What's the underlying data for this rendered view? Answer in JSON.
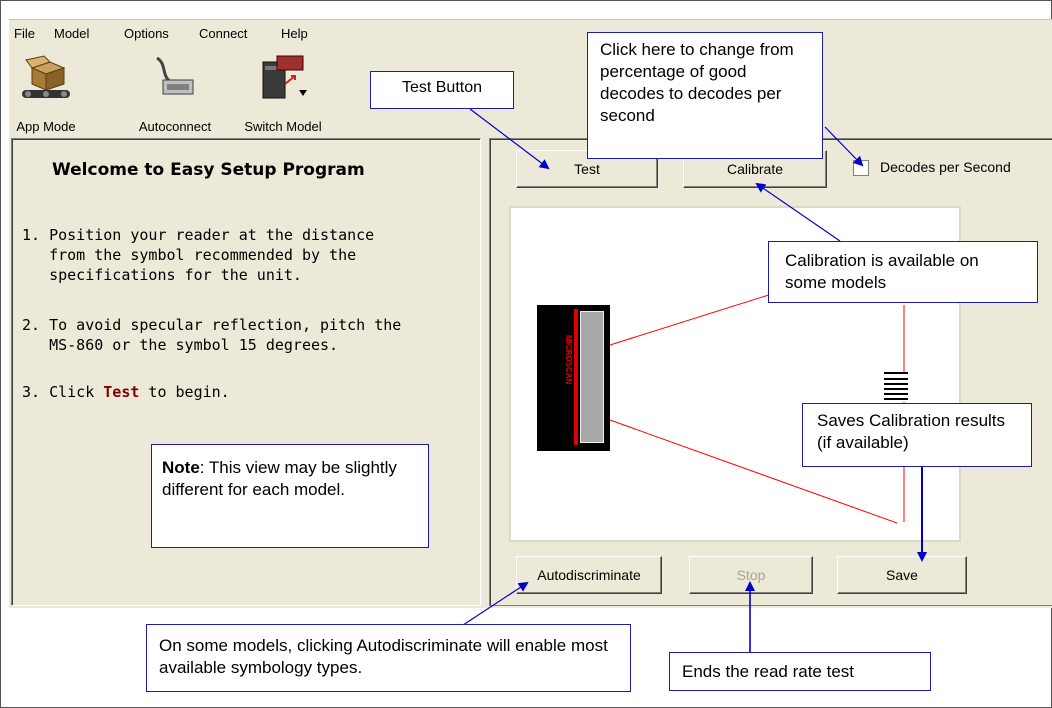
{
  "menu": [
    "File",
    "Model",
    "Options",
    "Connect",
    "Help"
  ],
  "toolbar": [
    {
      "label": "App Mode",
      "icon": "box-conveyor-icon"
    },
    {
      "label": "Autoconnect",
      "icon": "serial-cable-icon"
    },
    {
      "label": "Switch Model",
      "icon": "switch-model-icon"
    }
  ],
  "welcome": {
    "title": "Welcome to Easy Setup Program",
    "step1": "1. Position your reader at the distance\n   from the symbol recommended by the\n   specifications for the unit.",
    "step2": "2. To avoid specular reflection, pitch the\n   MS-860 or the symbol 15 degrees.",
    "step3_prefix": "3. Click ",
    "step3_bold": "Test",
    "step3_suffix": " to begin."
  },
  "buttons": {
    "test": "Test",
    "calibrate": "Calibrate",
    "autodiscriminate": "Autodiscriminate",
    "stop": "Stop",
    "save": "Save"
  },
  "checkbox": {
    "label": "Decodes per Second",
    "checked": false
  },
  "reader_text": "MICROSCAN",
  "callouts": {
    "test": "Test Button",
    "decodes": "Click here to change from percentage of good decodes to decodes per second",
    "calibration": "Calibration is available on some models",
    "save": "Saves Calibration results (if available)",
    "note_bold": "Note",
    "note_rest": ": This view may be slightly different for each model.",
    "autodiscriminate": "On some models, clicking Autodiscriminate will enable most available symbology types.",
    "stop": "Ends the read rate test"
  },
  "colors": {
    "callout_border": "#1c1ca8",
    "arrow": "#0000cc",
    "laser": "#ff0000",
    "highlight": "#800000"
  }
}
